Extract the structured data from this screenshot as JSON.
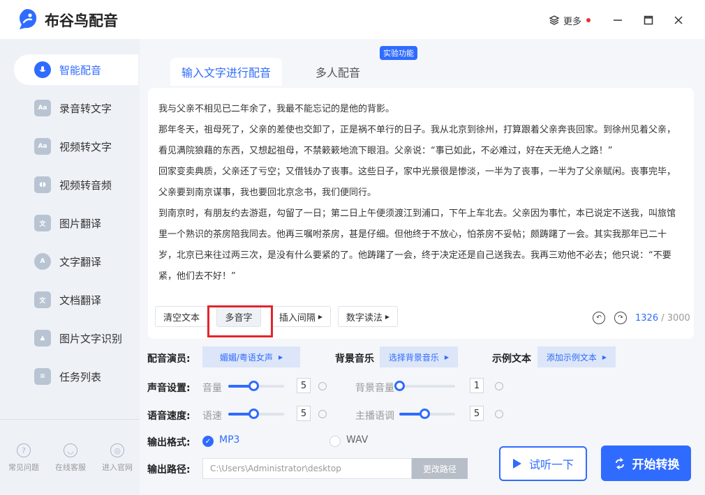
{
  "app": {
    "title": "布谷鸟配音",
    "more_label": "更多"
  },
  "colors": {
    "accent": "#2f6bff",
    "highlight": "#e3252b"
  },
  "sidebar": {
    "items": [
      {
        "label": "智能配音",
        "icon": "microphone-icon",
        "glyph": ""
      },
      {
        "label": "录音转文字",
        "icon": "audio-text-icon",
        "glyph": "Aa"
      },
      {
        "label": "视频转文字",
        "icon": "video-text-icon",
        "glyph": "Aa"
      },
      {
        "label": "视频转音频",
        "icon": "video-audio-icon",
        "glyph": "◖◗"
      },
      {
        "label": "图片翻译",
        "icon": "image-translate-icon",
        "glyph": "文"
      },
      {
        "label": "文字翻译",
        "icon": "text-translate-icon",
        "glyph": "A"
      },
      {
        "label": "文档翻译",
        "icon": "doc-translate-icon",
        "glyph": "文"
      },
      {
        "label": "图片文字识别",
        "icon": "ocr-icon",
        "glyph": "▲"
      },
      {
        "label": "任务列表",
        "icon": "task-list-icon",
        "glyph": "≡"
      }
    ],
    "bottom": [
      {
        "label": "常见问题",
        "icon": "question-icon",
        "glyph": "?"
      },
      {
        "label": "在线客服",
        "icon": "headset-icon",
        "glyph": "◡"
      },
      {
        "label": "进入官网",
        "icon": "planet-icon",
        "glyph": "◎"
      }
    ]
  },
  "tabs": {
    "tab1": "输入文字进行配音",
    "tab2": "多人配音",
    "badge": "实验功能"
  },
  "editor": {
    "text": "我与父亲不相见已二年余了，我最不能忘记的是他的背影。\n那年冬天，祖母死了，父亲的差使也交卸了，正是祸不单行的日子。我从北京到徐州，打算跟着父亲奔丧回家。到徐州见着父亲，看见满院狼藉的东西，又想起祖母，不禁簌簌地流下眼泪。父亲说：“事已如此，不必难过，好在天无绝人之路！”\n回家变卖典质，父亲还了亏空；又借钱办了丧事。这些日子，家中光景很是惨淡，一半为了丧事，一半为了父亲赋闲。丧事完毕，父亲要到南京谋事，我也要回北京念书，我们便同行。\n到南京时，有朋友约去游逛，勾留了一日；第二日上午便须渡江到浦口，下午上车北去。父亲因为事忙，本已说定不送我，叫旅馆里一个熟识的茶房陪我同去。他再三嘱咐茶房，甚是仔细。但他终于不放心，怕茶房不妥帖；颇踌躇了一会。其实我那年已二十岁，北京已来往过两三次，是没有什么要紧的了。他踌躇了一会，终于决定还是自己送我去。我再三劝他不必去；他只说：“不要紧，他们去不好！”",
    "clear_btn": "清空文本",
    "poly_btn": "多音字",
    "pause_btn": "插入间隔",
    "num_btn": "数字读法",
    "count": "1326",
    "max": "/ 3000"
  },
  "settings": {
    "voice_label": "配音演员:",
    "voice_value": "媚媚/粤语女声",
    "bgm_label": "背景音乐",
    "bgm_value": "选择背景音乐",
    "sample_label": "示例文本",
    "sample_value": "添加示例文本",
    "sound_label": "声音设置:",
    "volume_label": "音量",
    "volume_value": "5",
    "volume_level": 0.45,
    "bgvol_label": "背景音量",
    "bgvol_value": "1",
    "bgvol_level": 0.0,
    "speed_section_label": "语音速度:",
    "speed_label": "语速",
    "speed_value": "5",
    "speed_level": 0.45,
    "tone_label": "主播语调",
    "tone_value": "5",
    "tone_level": 0.45,
    "format_label": "输出格式:",
    "mp3": "MP3",
    "wav": "WAV",
    "path_label": "输出路径:",
    "path_value": "C:\\Users\\Administrator\\desktop",
    "path_btn": "更改路径"
  },
  "actions": {
    "preview": "试听一下",
    "start": "开始转换"
  }
}
